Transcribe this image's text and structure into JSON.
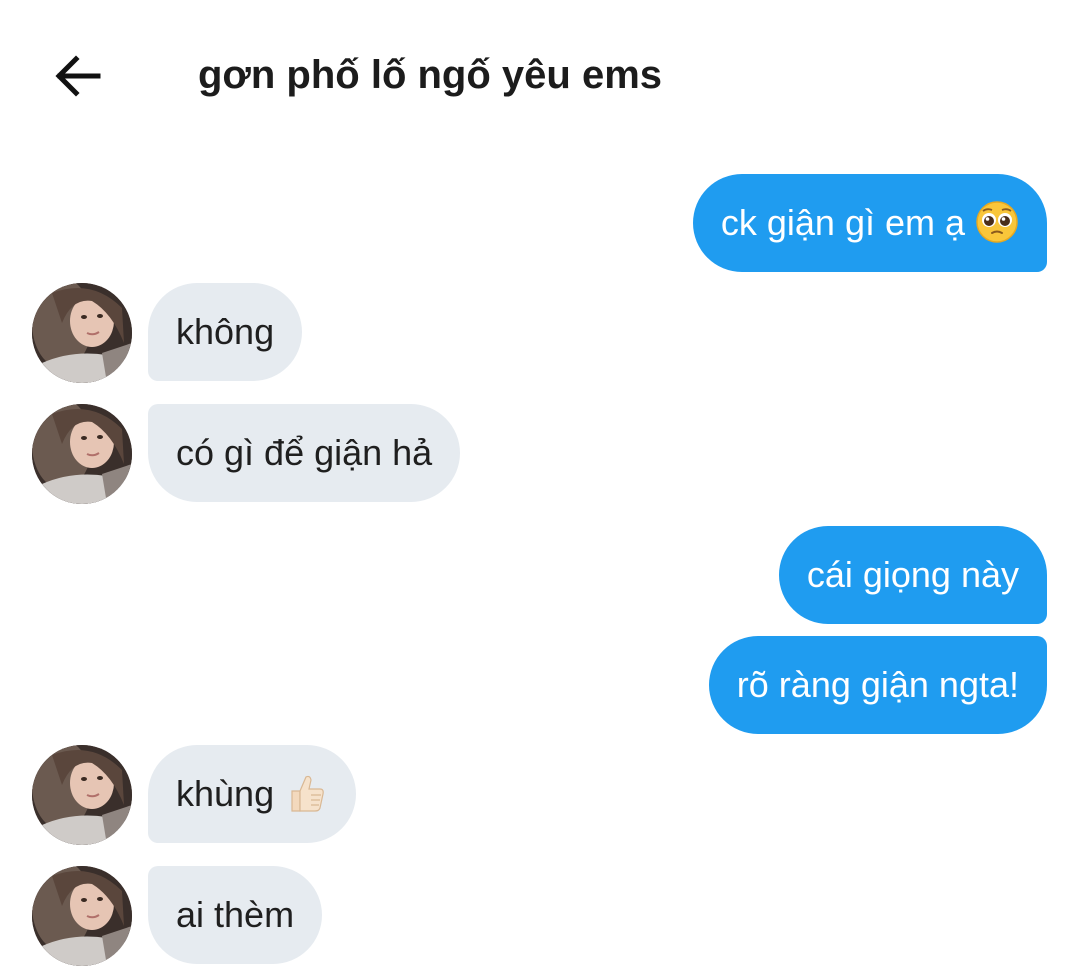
{
  "header": {
    "back_icon": "arrow-left-icon",
    "title": "gơn phố lố ngố yêu ems"
  },
  "colors": {
    "outgoing_bubble": "#1f9cf0",
    "incoming_bubble": "#e6ebf0"
  },
  "messages": [
    {
      "direction": "outgoing",
      "text": "ck giận gì em ạ",
      "emoji": "pleading-face-emoji"
    },
    {
      "direction": "incoming",
      "text": "không"
    },
    {
      "direction": "incoming",
      "text": "có gì để giận hả"
    },
    {
      "direction": "outgoing",
      "text": "cái giọng này"
    },
    {
      "direction": "outgoing",
      "text": "rõ ràng giận ngta!"
    },
    {
      "direction": "incoming",
      "text": "khùng",
      "emoji": "thumbs-up-emoji"
    },
    {
      "direction": "incoming",
      "text": "ai thèm"
    }
  ]
}
